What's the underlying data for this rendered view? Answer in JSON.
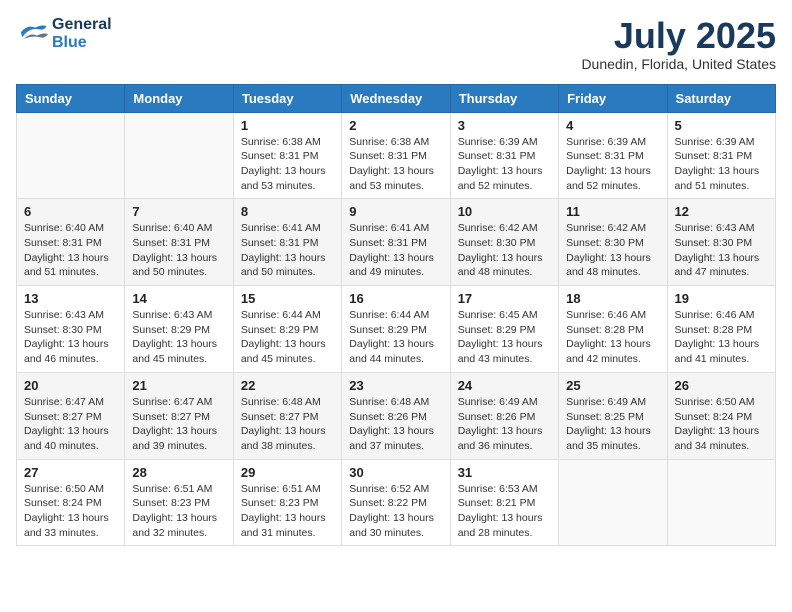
{
  "logo": {
    "line1": "General",
    "line2": "Blue"
  },
  "title": "July 2025",
  "location": "Dunedin, Florida, United States",
  "weekdays": [
    "Sunday",
    "Monday",
    "Tuesday",
    "Wednesday",
    "Thursday",
    "Friday",
    "Saturday"
  ],
  "weeks": [
    [
      {
        "day": "",
        "info": ""
      },
      {
        "day": "",
        "info": ""
      },
      {
        "day": "1",
        "info": "Sunrise: 6:38 AM\nSunset: 8:31 PM\nDaylight: 13 hours\nand 53 minutes."
      },
      {
        "day": "2",
        "info": "Sunrise: 6:38 AM\nSunset: 8:31 PM\nDaylight: 13 hours\nand 53 minutes."
      },
      {
        "day": "3",
        "info": "Sunrise: 6:39 AM\nSunset: 8:31 PM\nDaylight: 13 hours\nand 52 minutes."
      },
      {
        "day": "4",
        "info": "Sunrise: 6:39 AM\nSunset: 8:31 PM\nDaylight: 13 hours\nand 52 minutes."
      },
      {
        "day": "5",
        "info": "Sunrise: 6:39 AM\nSunset: 8:31 PM\nDaylight: 13 hours\nand 51 minutes."
      }
    ],
    [
      {
        "day": "6",
        "info": "Sunrise: 6:40 AM\nSunset: 8:31 PM\nDaylight: 13 hours\nand 51 minutes."
      },
      {
        "day": "7",
        "info": "Sunrise: 6:40 AM\nSunset: 8:31 PM\nDaylight: 13 hours\nand 50 minutes."
      },
      {
        "day": "8",
        "info": "Sunrise: 6:41 AM\nSunset: 8:31 PM\nDaylight: 13 hours\nand 50 minutes."
      },
      {
        "day": "9",
        "info": "Sunrise: 6:41 AM\nSunset: 8:31 PM\nDaylight: 13 hours\nand 49 minutes."
      },
      {
        "day": "10",
        "info": "Sunrise: 6:42 AM\nSunset: 8:30 PM\nDaylight: 13 hours\nand 48 minutes."
      },
      {
        "day": "11",
        "info": "Sunrise: 6:42 AM\nSunset: 8:30 PM\nDaylight: 13 hours\nand 48 minutes."
      },
      {
        "day": "12",
        "info": "Sunrise: 6:43 AM\nSunset: 8:30 PM\nDaylight: 13 hours\nand 47 minutes."
      }
    ],
    [
      {
        "day": "13",
        "info": "Sunrise: 6:43 AM\nSunset: 8:30 PM\nDaylight: 13 hours\nand 46 minutes."
      },
      {
        "day": "14",
        "info": "Sunrise: 6:43 AM\nSunset: 8:29 PM\nDaylight: 13 hours\nand 45 minutes."
      },
      {
        "day": "15",
        "info": "Sunrise: 6:44 AM\nSunset: 8:29 PM\nDaylight: 13 hours\nand 45 minutes."
      },
      {
        "day": "16",
        "info": "Sunrise: 6:44 AM\nSunset: 8:29 PM\nDaylight: 13 hours\nand 44 minutes."
      },
      {
        "day": "17",
        "info": "Sunrise: 6:45 AM\nSunset: 8:29 PM\nDaylight: 13 hours\nand 43 minutes."
      },
      {
        "day": "18",
        "info": "Sunrise: 6:46 AM\nSunset: 8:28 PM\nDaylight: 13 hours\nand 42 minutes."
      },
      {
        "day": "19",
        "info": "Sunrise: 6:46 AM\nSunset: 8:28 PM\nDaylight: 13 hours\nand 41 minutes."
      }
    ],
    [
      {
        "day": "20",
        "info": "Sunrise: 6:47 AM\nSunset: 8:27 PM\nDaylight: 13 hours\nand 40 minutes."
      },
      {
        "day": "21",
        "info": "Sunrise: 6:47 AM\nSunset: 8:27 PM\nDaylight: 13 hours\nand 39 minutes."
      },
      {
        "day": "22",
        "info": "Sunrise: 6:48 AM\nSunset: 8:27 PM\nDaylight: 13 hours\nand 38 minutes."
      },
      {
        "day": "23",
        "info": "Sunrise: 6:48 AM\nSunset: 8:26 PM\nDaylight: 13 hours\nand 37 minutes."
      },
      {
        "day": "24",
        "info": "Sunrise: 6:49 AM\nSunset: 8:26 PM\nDaylight: 13 hours\nand 36 minutes."
      },
      {
        "day": "25",
        "info": "Sunrise: 6:49 AM\nSunset: 8:25 PM\nDaylight: 13 hours\nand 35 minutes."
      },
      {
        "day": "26",
        "info": "Sunrise: 6:50 AM\nSunset: 8:24 PM\nDaylight: 13 hours\nand 34 minutes."
      }
    ],
    [
      {
        "day": "27",
        "info": "Sunrise: 6:50 AM\nSunset: 8:24 PM\nDaylight: 13 hours\nand 33 minutes."
      },
      {
        "day": "28",
        "info": "Sunrise: 6:51 AM\nSunset: 8:23 PM\nDaylight: 13 hours\nand 32 minutes."
      },
      {
        "day": "29",
        "info": "Sunrise: 6:51 AM\nSunset: 8:23 PM\nDaylight: 13 hours\nand 31 minutes."
      },
      {
        "day": "30",
        "info": "Sunrise: 6:52 AM\nSunset: 8:22 PM\nDaylight: 13 hours\nand 30 minutes."
      },
      {
        "day": "31",
        "info": "Sunrise: 6:53 AM\nSunset: 8:21 PM\nDaylight: 13 hours\nand 28 minutes."
      },
      {
        "day": "",
        "info": ""
      },
      {
        "day": "",
        "info": ""
      }
    ]
  ]
}
